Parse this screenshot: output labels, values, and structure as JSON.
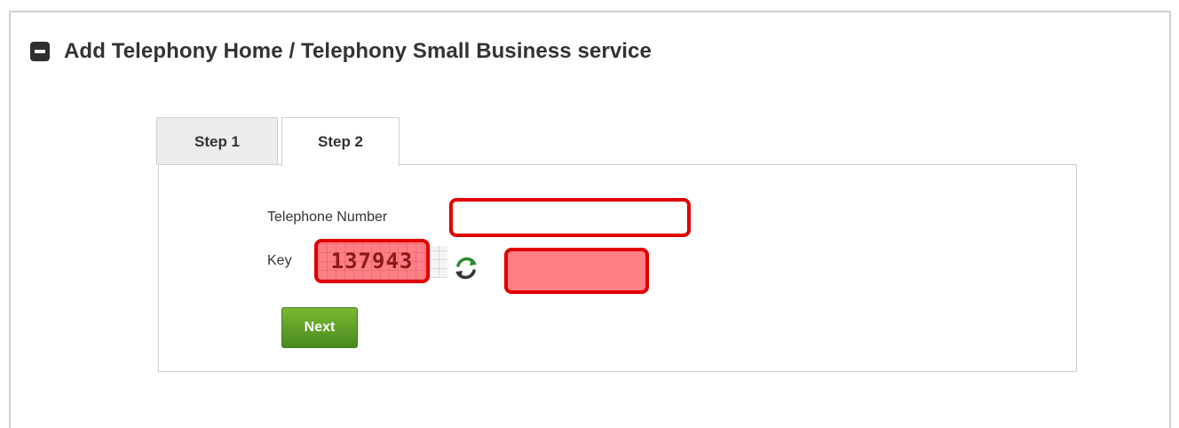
{
  "panel": {
    "title": "Add Telephony Home / Telephony Small Business service",
    "collapse_icon": "minus-square-icon"
  },
  "tabs": [
    {
      "label": "Step 1",
      "active": false
    },
    {
      "label": "Step 2",
      "active": true
    }
  ],
  "form": {
    "telephone_label": "Telephone Number",
    "telephone_value": "",
    "key_label": "Key",
    "captcha_text": "137943",
    "refresh_icon": "refresh-icon",
    "key_value": "",
    "next_label": "Next"
  },
  "colors": {
    "highlight_border": "#e00000",
    "highlight_fill": "#ff7f86",
    "next_button": "#5a9a24"
  }
}
